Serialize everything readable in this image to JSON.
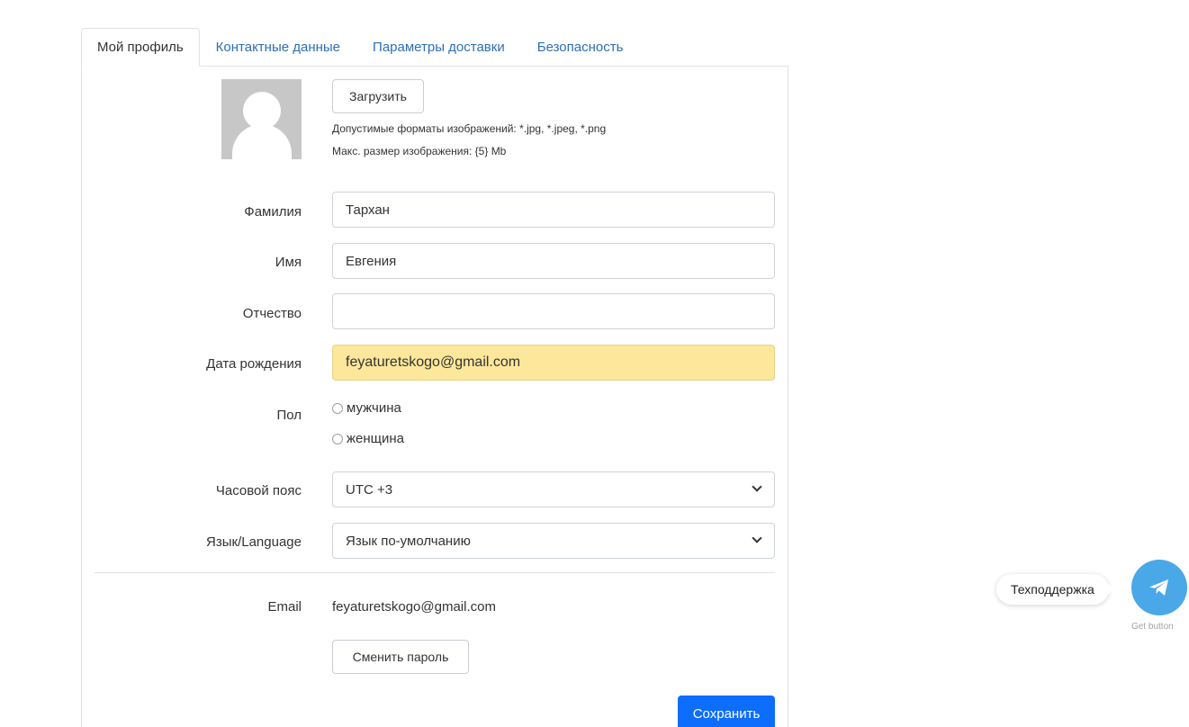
{
  "tabs": [
    {
      "label": "Мой профиль",
      "active": true
    },
    {
      "label": "Контактные данные",
      "active": false
    },
    {
      "label": "Параметры доставки",
      "active": false
    },
    {
      "label": "Безопасность",
      "active": false
    }
  ],
  "avatar": {
    "upload_label": "Загрузить",
    "formats_hint": "Допустимые форматы изображений: *.jpg, *.jpeg, *.png",
    "size_hint": "Макс. размер изображения: {5} Mb"
  },
  "form": {
    "last_name": {
      "label": "Фамилия",
      "value": "Тархан"
    },
    "first_name": {
      "label": "Имя",
      "value": "Евгения"
    },
    "middle_name": {
      "label": "Отчество",
      "value": ""
    },
    "birth_date": {
      "label": "Дата рождения",
      "value": "feyaturetskogo@gmail.com"
    },
    "gender": {
      "label": "Пол",
      "options": [
        "мужчина",
        "женщина"
      ]
    },
    "timezone": {
      "label": "Часовой пояс",
      "value": "UTC +3"
    },
    "language": {
      "label": "Язык/Language",
      "value": "Язык по-умолчанию"
    },
    "email": {
      "label": "Email",
      "value": "feyaturetskogo@gmail.com"
    }
  },
  "buttons": {
    "change_password": "Сменить пароль",
    "save": "Сохранить"
  },
  "support": {
    "label": "Техподдержка",
    "footer": "Get button",
    "icon": "telegram-icon",
    "color": "#4aa7e8"
  },
  "colors": {
    "primary": "#0d6efd",
    "link": "#2e6fb7",
    "autofill": "#fde79a"
  }
}
